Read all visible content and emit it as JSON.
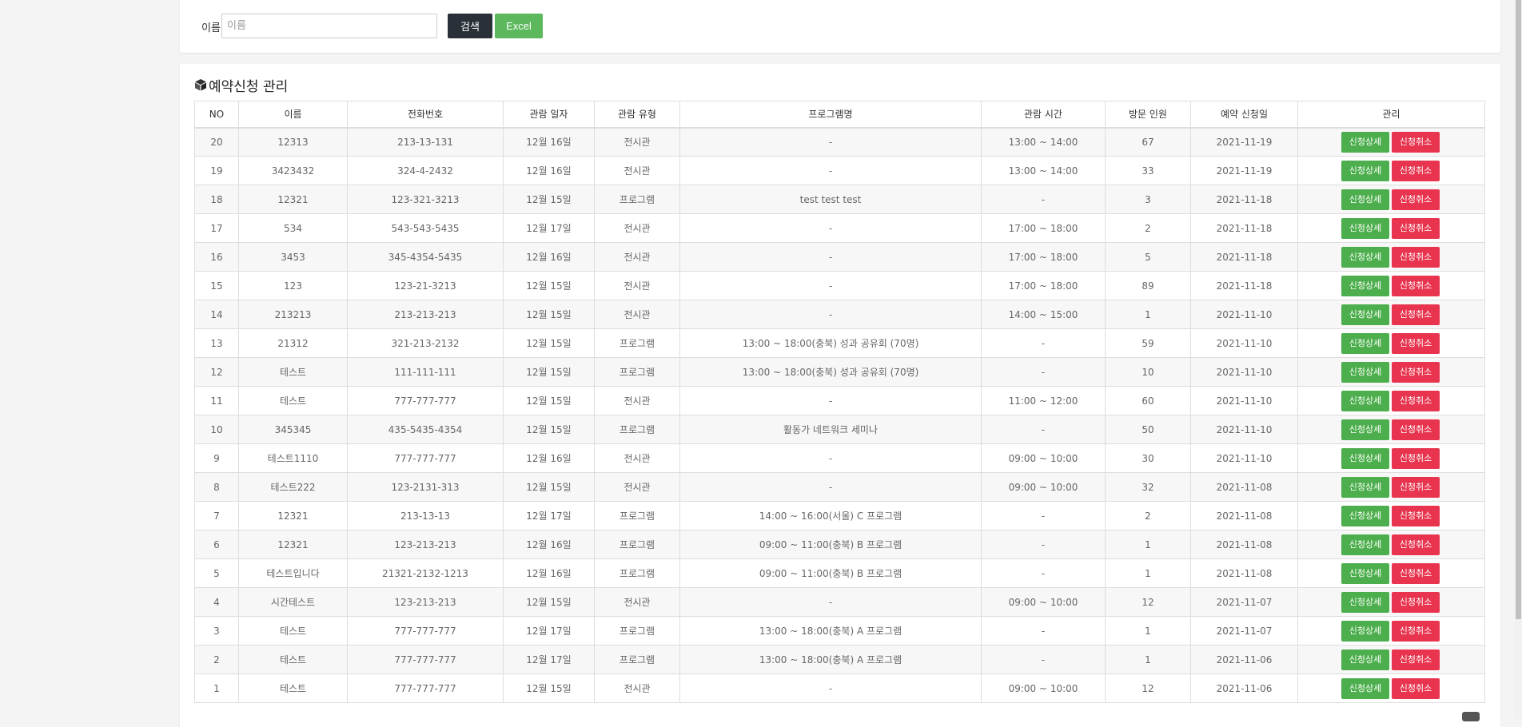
{
  "search": {
    "label": "이름",
    "placeholder": "이름",
    "search_button": "검색",
    "excel_button": "Excel"
  },
  "panel": {
    "title": "예약신청 관리"
  },
  "table": {
    "headers": [
      "NO",
      "이름",
      "전화번호",
      "관람 일자",
      "관람 유형",
      "프로그램명",
      "관람 시간",
      "방문 인원",
      "예약 신청일",
      "관리"
    ],
    "detail_label": "신청상세",
    "cancel_label": "신청취소",
    "rows": [
      {
        "no": "20",
        "name": "12313",
        "phone": "213-13-131",
        "date": "12월 16일",
        "type": "전시관",
        "program": "-",
        "time": "13:00 ~ 14:00",
        "visitors": "67",
        "applied": "2021-11-19"
      },
      {
        "no": "19",
        "name": "3423432",
        "phone": "324-4-2432",
        "date": "12월 16일",
        "type": "전시관",
        "program": "-",
        "time": "13:00 ~ 14:00",
        "visitors": "33",
        "applied": "2021-11-19"
      },
      {
        "no": "18",
        "name": "12321",
        "phone": "123-321-3213",
        "date": "12월 15일",
        "type": "프로그램",
        "program": "test test test",
        "time": "-",
        "visitors": "3",
        "applied": "2021-11-18"
      },
      {
        "no": "17",
        "name": "534",
        "phone": "543-543-5435",
        "date": "12월 17일",
        "type": "전시관",
        "program": "-",
        "time": "17:00 ~ 18:00",
        "visitors": "2",
        "applied": "2021-11-18"
      },
      {
        "no": "16",
        "name": "3453",
        "phone": "345-4354-5435",
        "date": "12월 16일",
        "type": "전시관",
        "program": "-",
        "time": "17:00 ~ 18:00",
        "visitors": "5",
        "applied": "2021-11-18"
      },
      {
        "no": "15",
        "name": "123",
        "phone": "123-21-3213",
        "date": "12월 15일",
        "type": "전시관",
        "program": "-",
        "time": "17:00 ~ 18:00",
        "visitors": "89",
        "applied": "2021-11-18"
      },
      {
        "no": "14",
        "name": "213213",
        "phone": "213-213-213",
        "date": "12월 15일",
        "type": "전시관",
        "program": "-",
        "time": "14:00 ~ 15:00",
        "visitors": "1",
        "applied": "2021-11-10"
      },
      {
        "no": "13",
        "name": "21312",
        "phone": "321-213-2132",
        "date": "12월 15일",
        "type": "프로그램",
        "program": "13:00 ~ 18:00(충북) 성과 공유회 (70명)",
        "time": "-",
        "visitors": "59",
        "applied": "2021-11-10"
      },
      {
        "no": "12",
        "name": "테스트",
        "phone": "111-111-111",
        "date": "12월 15일",
        "type": "프로그램",
        "program": "13:00 ~ 18:00(충북) 성과 공유회 (70명)",
        "time": "-",
        "visitors": "10",
        "applied": "2021-11-10"
      },
      {
        "no": "11",
        "name": "테스트",
        "phone": "777-777-777",
        "date": "12월 15일",
        "type": "전시관",
        "program": "-",
        "time": "11:00 ~ 12:00",
        "visitors": "60",
        "applied": "2021-11-10"
      },
      {
        "no": "10",
        "name": "345345",
        "phone": "435-5435-4354",
        "date": "12월 15일",
        "type": "프로그램",
        "program": "활동가 네트워크 세미나",
        "time": "-",
        "visitors": "50",
        "applied": "2021-11-10"
      },
      {
        "no": "9",
        "name": "테스트1110",
        "phone": "777-777-777",
        "date": "12월 16일",
        "type": "전시관",
        "program": "-",
        "time": "09:00 ~ 10:00",
        "visitors": "30",
        "applied": "2021-11-10"
      },
      {
        "no": "8",
        "name": "테스트222",
        "phone": "123-2131-313",
        "date": "12월 15일",
        "type": "전시관",
        "program": "-",
        "time": "09:00 ~ 10:00",
        "visitors": "32",
        "applied": "2021-11-08"
      },
      {
        "no": "7",
        "name": "12321",
        "phone": "213-13-13",
        "date": "12월 17일",
        "type": "프로그램",
        "program": "14:00 ~ 16:00(서울) C 프로그램",
        "time": "-",
        "visitors": "2",
        "applied": "2021-11-08"
      },
      {
        "no": "6",
        "name": "12321",
        "phone": "123-213-213",
        "date": "12월 16일",
        "type": "프로그램",
        "program": "09:00 ~ 11:00(충북) B 프로그램",
        "time": "-",
        "visitors": "1",
        "applied": "2021-11-08"
      },
      {
        "no": "5",
        "name": "테스트입니다",
        "phone": "21321-2132-1213",
        "date": "12월 16일",
        "type": "프로그램",
        "program": "09:00 ~ 11:00(충북) B 프로그램",
        "time": "-",
        "visitors": "1",
        "applied": "2021-11-08"
      },
      {
        "no": "4",
        "name": "시간테스트",
        "phone": "123-213-213",
        "date": "12월 15일",
        "type": "전시관",
        "program": "-",
        "time": "09:00 ~ 10:00",
        "visitors": "12",
        "applied": "2021-11-07"
      },
      {
        "no": "3",
        "name": "테스트",
        "phone": "777-777-777",
        "date": "12월 17일",
        "type": "프로그램",
        "program": "13:00 ~ 18:00(충북) A 프로그램",
        "time": "-",
        "visitors": "1",
        "applied": "2021-11-07"
      },
      {
        "no": "2",
        "name": "테스트",
        "phone": "777-777-777",
        "date": "12월 17일",
        "type": "프로그램",
        "program": "13:00 ~ 18:00(충북) A 프로그램",
        "time": "-",
        "visitors": "1",
        "applied": "2021-11-06"
      },
      {
        "no": "1",
        "name": "테스트",
        "phone": "777-777-777",
        "date": "12월 15일",
        "type": "전시관",
        "program": "-",
        "time": "09:00 ~ 10:00",
        "visitors": "12",
        "applied": "2021-11-06"
      }
    ]
  },
  "icons": {
    "panel_icon": "cube-icon"
  },
  "colors": {
    "search_button": "#2a3038",
    "excel_button": "#5cb85c",
    "detail_button": "#4cae4c",
    "cancel_button": "#e8344e"
  }
}
